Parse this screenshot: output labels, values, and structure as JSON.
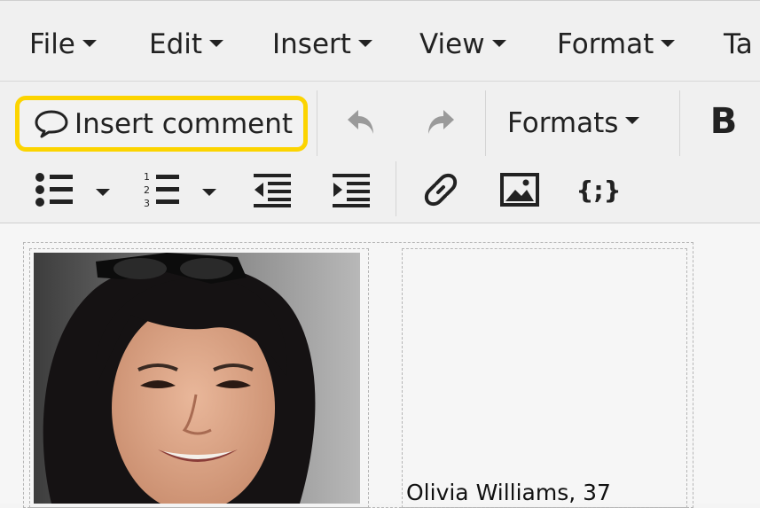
{
  "menubar": {
    "items": [
      {
        "label": "File"
      },
      {
        "label": "Edit"
      },
      {
        "label": "Insert"
      },
      {
        "label": "View"
      },
      {
        "label": "Format"
      },
      {
        "label": "Ta"
      }
    ]
  },
  "toolbar": {
    "insert_comment_label": "Insert comment",
    "formats_label": "Formats",
    "bold_label": "B",
    "code_sample_label": "{;}"
  },
  "content": {
    "caption": "Olivia Williams, 37"
  },
  "colors": {
    "highlight": "#fcd400",
    "toolbar_bg": "#f0f0f0",
    "disabled_icon": "#9a9a9a"
  }
}
